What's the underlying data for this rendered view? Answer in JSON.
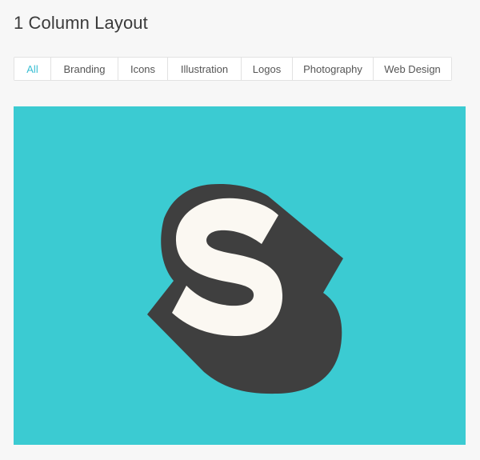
{
  "page": {
    "title": "1 Column Layout"
  },
  "filters": {
    "active_index": 0,
    "items": [
      {
        "label": "All"
      },
      {
        "label": "Branding"
      },
      {
        "label": "Icons"
      },
      {
        "label": "Illustration"
      },
      {
        "label": "Logos"
      },
      {
        "label": "Photography"
      },
      {
        "label": "Web Design"
      }
    ]
  },
  "colors": {
    "accent": "#3bbfd3",
    "hero_background": "#3bcbd2",
    "logo_shadow": "#3f3f3f",
    "logo_letter": "#fbf8f2"
  },
  "hero": {
    "icon": "s-logo-icon"
  }
}
